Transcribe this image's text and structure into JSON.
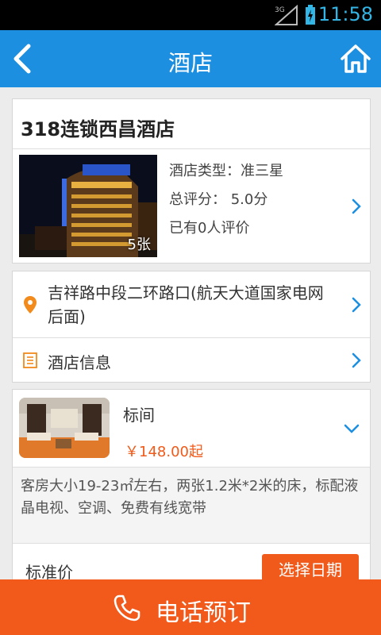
{
  "status_bar": {
    "network": "3G",
    "time": "11:58"
  },
  "nav": {
    "title": "酒店",
    "back_icon": "back-arrow-icon",
    "home_icon": "home-icon",
    "color": "#1c8fe0"
  },
  "hotel": {
    "name": "318连锁西昌酒店",
    "photo_count": "5张",
    "type_line": "酒店类型：准三星",
    "score_line": "总评分： 5.0分",
    "reviews_line": "已有0人评价"
  },
  "address": {
    "text": "吉祥路中段二环路口(航天大道国家电网后面)",
    "info_label": "酒店信息"
  },
  "room": {
    "name": "标间",
    "price": "￥148.00起",
    "description": "客房大小19-23㎡左右，两张1.2米*2米的床，标配液晶电视、空调、免费有线宽带",
    "standard_price_label": "标准价",
    "select_date_label": "选择日期"
  },
  "call_bar": {
    "label": "电话预订",
    "color": "#f25a1c"
  }
}
